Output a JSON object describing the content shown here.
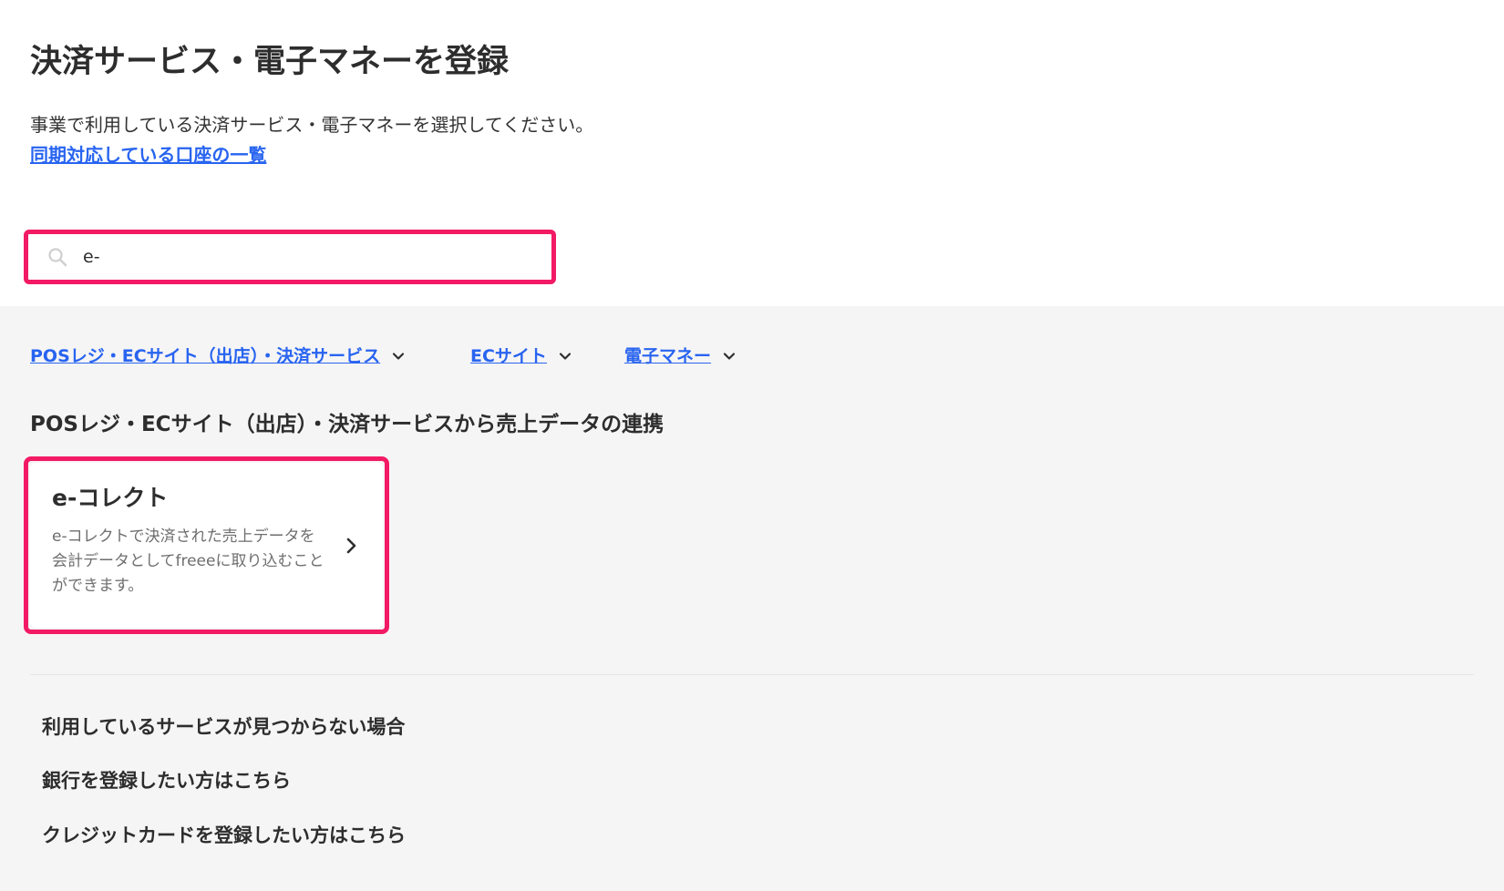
{
  "header": {
    "title": "決済サービス・電子マネーを登録",
    "description": "事業で利用している決済サービス・電子マネーを選択してください。",
    "sync_link_label": "同期対応している口座の一覧"
  },
  "search": {
    "value": "e-",
    "icon": "search-icon"
  },
  "filter_tabs": [
    {
      "label": "POSレジ・ECサイト（出店）・決済サービス",
      "icon": "chevron-down-icon"
    },
    {
      "label": "ECサイト",
      "icon": "chevron-down-icon"
    },
    {
      "label": "電子マネー",
      "icon": "chevron-down-icon"
    }
  ],
  "section": {
    "title": "POSレジ・ECサイト（出店）・決済サービスから売上データの連携"
  },
  "service_card": {
    "title": "e-コレクト",
    "description": "e-コレクトで決済された売上データを会計データとしてfreeeに取り込むことができます。",
    "icon": "chevron-right-icon"
  },
  "help_links": [
    "利用しているサービスが見つからない場合",
    "銀行を登録したい方はこちら",
    "クレジットカードを登録したい方はこちら"
  ],
  "colors": {
    "link_blue": "#2864f0",
    "highlight_pink": "#f21a64",
    "panel_gray": "#f6f5f5",
    "text_dark": "#2d2d2d"
  }
}
